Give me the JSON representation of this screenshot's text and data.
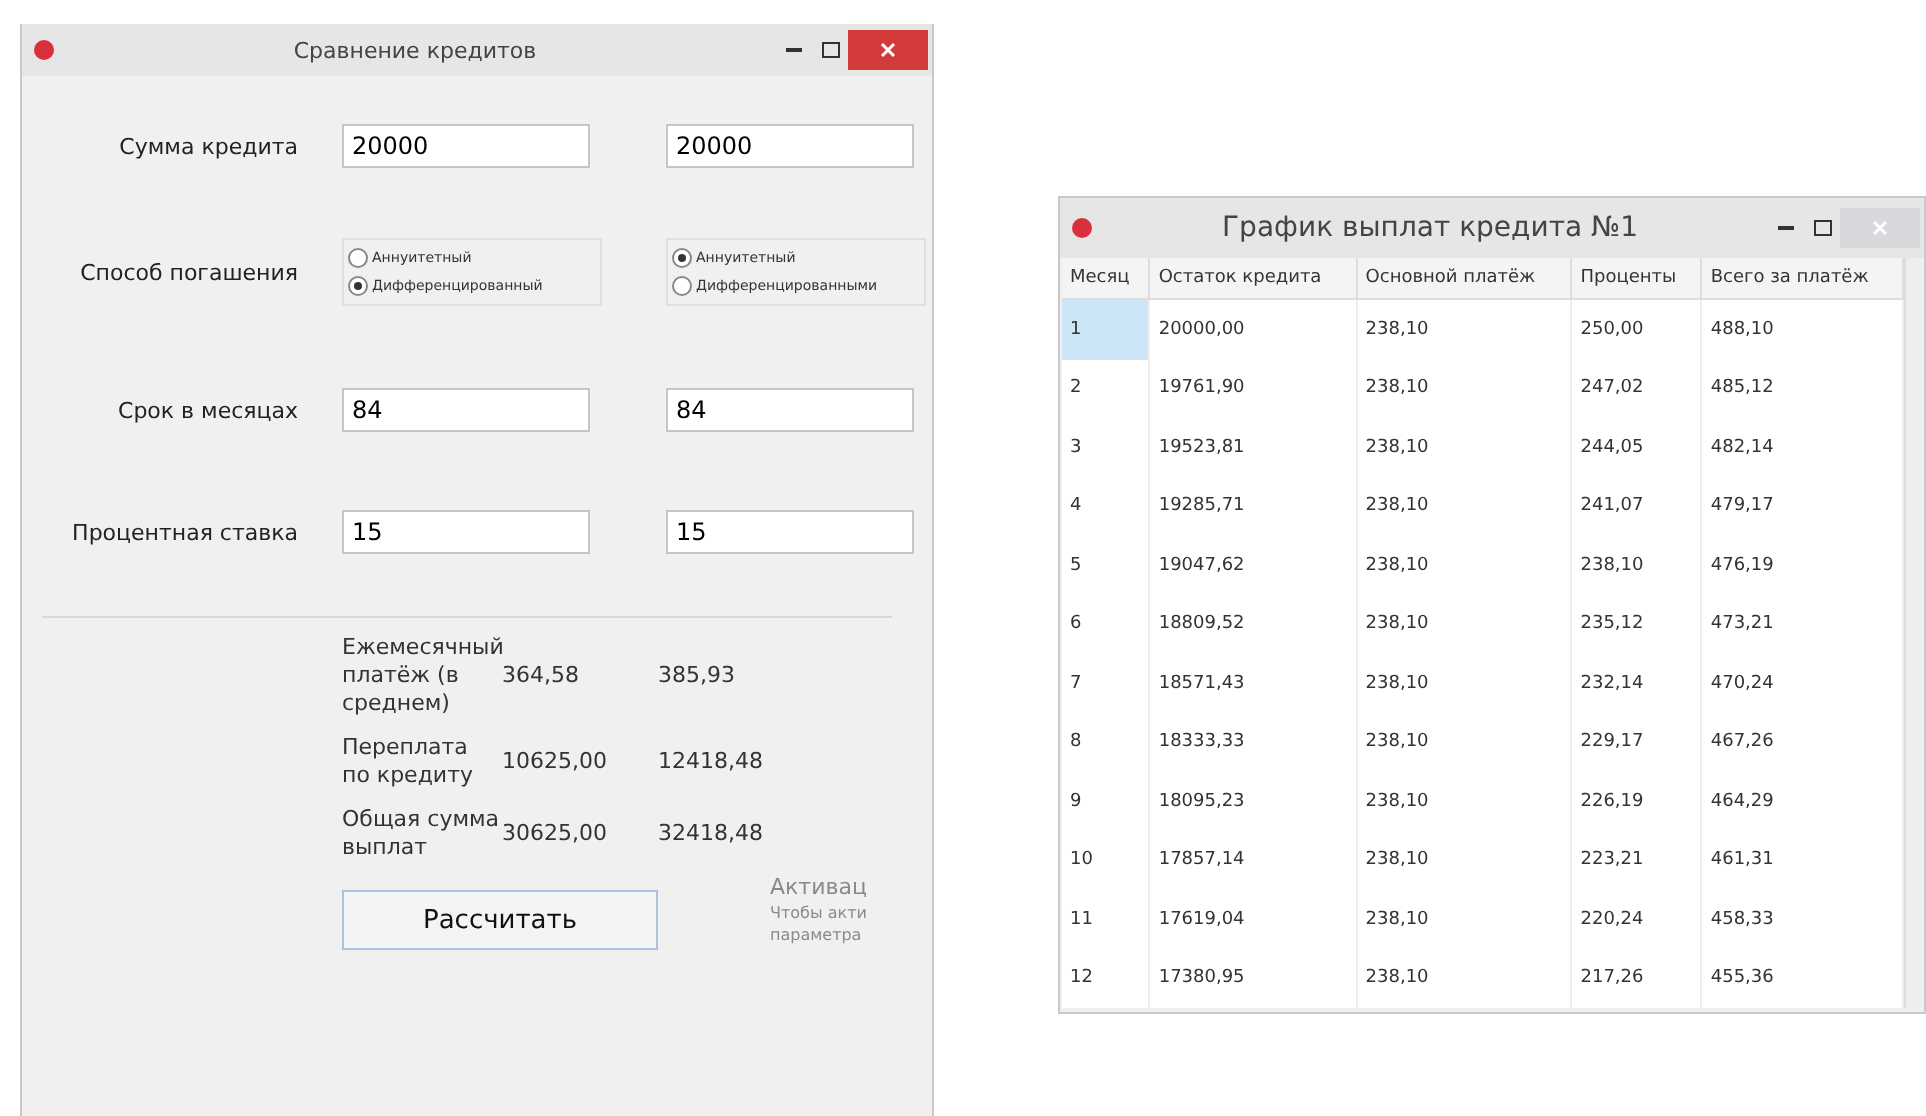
{
  "compare_window": {
    "title": "Сравнение кредитов",
    "inputs": [
      {
        "label": "Сумма кредита",
        "values": [
          "20000",
          "20000"
        ]
      },
      {
        "kind": "radio",
        "label": "Способ погашения",
        "groups": [
          [
            {
              "label": "Аннуитетный",
              "selected": false
            },
            {
              "label": "Дифференцированный",
              "selected": true
            }
          ],
          [
            {
              "label": "Аннуитетный",
              "selected": true
            },
            {
              "label": "Дифференцированными",
              "selected": false
            }
          ]
        ]
      },
      {
        "label": "Срок в месяцах",
        "values": [
          "84",
          "84"
        ]
      },
      {
        "label": "Процентная ставка",
        "values": [
          "15",
          "15"
        ]
      }
    ],
    "results": [
      {
        "label": "Ежемесячный платёж (в среднем)",
        "values": [
          "364,58",
          "385,93"
        ]
      },
      {
        "label": "Переплата по кредиту",
        "values": [
          "10625,00",
          "12418,48"
        ]
      },
      {
        "label": "Общая сумма выплат",
        "values": [
          "30625,00",
          "32418,48"
        ]
      }
    ],
    "activation_notice": [
      "Активац",
      "Чтобы акти",
      "параметра"
    ],
    "button": "Рассчитать"
  },
  "schedule_window": {
    "title": "График выплат кредита №1",
    "columns": [
      "Месяц",
      "Остаток кредита",
      "Основной платёж",
      "Проценты",
      "Всего за платёж"
    ],
    "rows": [
      {
        "cells": [
          "1",
          "20000,00",
          "238,10",
          "250,00",
          "488,10"
        ],
        "selected": true
      },
      {
        "cells": [
          "2",
          "19761,90",
          "238,10",
          "247,02",
          "485,12"
        ],
        "selected": false
      },
      {
        "cells": [
          "3",
          "19523,81",
          "238,10",
          "244,05",
          "482,14"
        ],
        "selected": false
      },
      {
        "cells": [
          "4",
          "19285,71",
          "238,10",
          "241,07",
          "479,17"
        ],
        "selected": false
      },
      {
        "cells": [
          "5",
          "19047,62",
          "238,10",
          "238,10",
          "476,19"
        ],
        "selected": false
      },
      {
        "cells": [
          "6",
          "18809,52",
          "238,10",
          "235,12",
          "473,21"
        ],
        "selected": false
      },
      {
        "cells": [
          "7",
          "18571,43",
          "238,10",
          "232,14",
          "470,24"
        ],
        "selected": false
      },
      {
        "cells": [
          "8",
          "18333,33",
          "238,10",
          "229,17",
          "467,26"
        ],
        "selected": false
      },
      {
        "cells": [
          "9",
          "18095,23",
          "238,10",
          "226,19",
          "464,29"
        ],
        "selected": false
      },
      {
        "cells": [
          "10",
          "17857,14",
          "238,10",
          "223,21",
          "461,31"
        ],
        "selected": false
      },
      {
        "cells": [
          "11",
          "17619,04",
          "238,10",
          "220,24",
          "458,33"
        ],
        "selected": false
      },
      {
        "cells": [
          "12",
          "17380,95",
          "238,10",
          "217,26",
          "455,36"
        ],
        "selected": false
      }
    ]
  }
}
